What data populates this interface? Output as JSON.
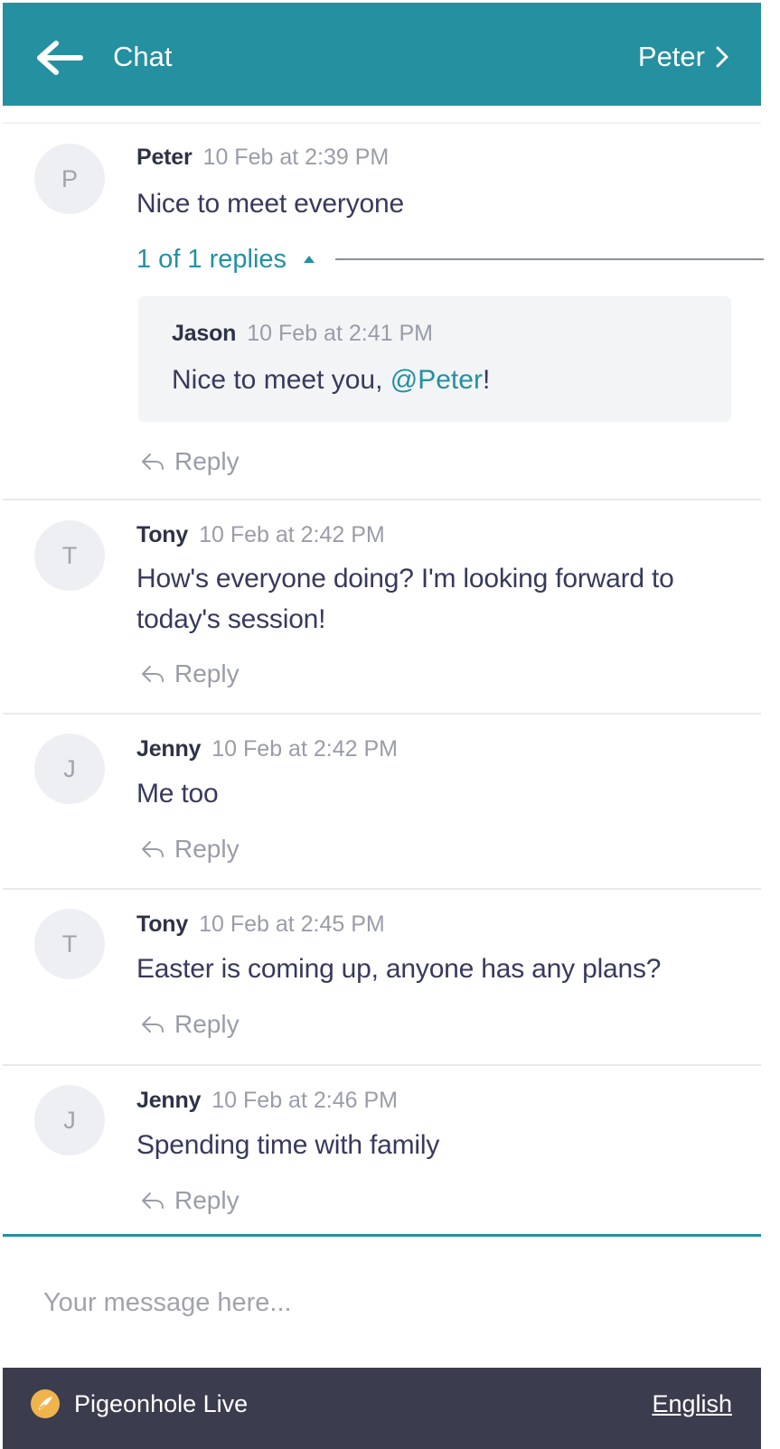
{
  "header": {
    "title": "Chat",
    "user_link": "Peter",
    "back_icon": "arrow-left-icon",
    "forward_icon": "chevron-right-icon",
    "bg_color": "#2490a0"
  },
  "messages": [
    {
      "initial": "P",
      "author": "Peter",
      "time": "10 Feb at 2:39 PM",
      "text": "Nice to meet everyone",
      "replies_label": "1 of 1 replies",
      "reply": {
        "author": "Jason",
        "time": "10 Feb at 2:41 PM",
        "text_before": "Nice to meet you, ",
        "mention": "@Peter",
        "text_after": "!"
      },
      "reply_button": "Reply"
    },
    {
      "initial": "T",
      "author": "Tony",
      "time": "10 Feb at 2:42 PM",
      "text": "How's everyone doing? I'm looking forward to today's session!",
      "reply_button": "Reply"
    },
    {
      "initial": "J",
      "author": "Jenny",
      "time": "10 Feb at 2:42 PM",
      "text": "Me too",
      "reply_button": "Reply"
    },
    {
      "initial": "T",
      "author": "Tony",
      "time": "10 Feb at 2:45 PM",
      "text": "Easter is coming up, anyone has any plans?",
      "reply_button": "Reply"
    },
    {
      "initial": "J",
      "author": "Jenny",
      "time": "10 Feb at 2:46 PM",
      "text": "Spending time with family",
      "reply_button": "Reply"
    }
  ],
  "composer": {
    "placeholder": "Your message here..."
  },
  "footer": {
    "brand": "Pigeonhole Live",
    "language": "English",
    "bg_color": "#3b3d4e"
  },
  "colors": {
    "accent": "#2490a0",
    "text": "#38395d",
    "muted": "#9a9da8",
    "reply_background": "#f3f4f6"
  }
}
